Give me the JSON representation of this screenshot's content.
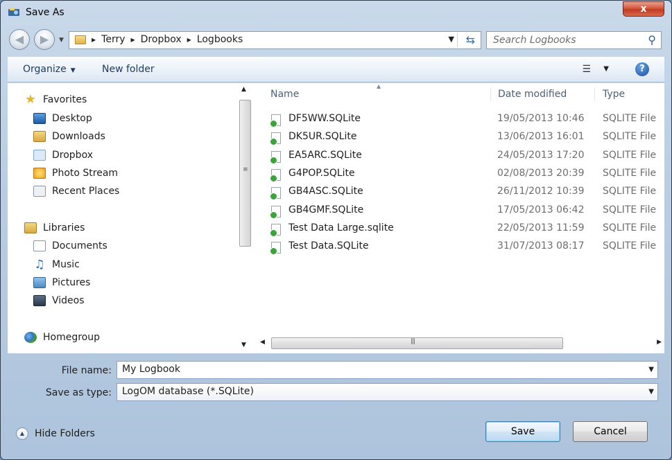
{
  "window": {
    "title": "Save As",
    "close_label": "x"
  },
  "address": {
    "crumbs": [
      "Terry",
      "Dropbox",
      "Logbooks"
    ]
  },
  "search": {
    "placeholder": "Search Logbooks"
  },
  "toolbar": {
    "organize_label": "Organize",
    "new_folder_label": "New folder",
    "help_label": "?"
  },
  "sidebar": {
    "favorites_label": "Favorites",
    "favorites": [
      {
        "label": "Desktop",
        "icon": "desktop-icon"
      },
      {
        "label": "Downloads",
        "icon": "downloads-icon"
      },
      {
        "label": "Dropbox",
        "icon": "dropbox-icon"
      },
      {
        "label": "Photo Stream",
        "icon": "photo-stream-icon"
      },
      {
        "label": "Recent Places",
        "icon": "recent-places-icon"
      }
    ],
    "libraries_label": "Libraries",
    "libraries": [
      {
        "label": "Documents",
        "icon": "documents-icon"
      },
      {
        "label": "Music",
        "icon": "music-icon"
      },
      {
        "label": "Pictures",
        "icon": "pictures-icon"
      },
      {
        "label": "Videos",
        "icon": "videos-icon"
      }
    ],
    "homegroup_label": "Homegroup"
  },
  "file_list": {
    "columns": {
      "name": "Name",
      "date": "Date modified",
      "type": "Type"
    },
    "files": [
      {
        "name": "DF5WW.SQLite",
        "date": "19/05/2013 10:46",
        "type": "SQLITE File"
      },
      {
        "name": "DK5UR.SQLite",
        "date": "13/06/2013 16:01",
        "type": "SQLITE File"
      },
      {
        "name": "EA5ARC.SQLite",
        "date": "24/05/2013 17:20",
        "type": "SQLITE File"
      },
      {
        "name": "G4POP.SQLite",
        "date": "02/08/2013 20:39",
        "type": "SQLITE File"
      },
      {
        "name": "GB4ASC.SQLite",
        "date": "26/11/2012 10:39",
        "type": "SQLITE File"
      },
      {
        "name": "GB4GMF.SQLite",
        "date": "17/05/2013 06:42",
        "type": "SQLITE File"
      },
      {
        "name": "Test Data Large.sqlite",
        "date": "22/05/2013 11:59",
        "type": "SQLITE File"
      },
      {
        "name": "Test Data.SQLite",
        "date": "31/07/2013 08:17",
        "type": "SQLITE File"
      }
    ]
  },
  "form": {
    "file_name_label": "File name:",
    "file_name_value": "My Logbook",
    "save_type_label": "Save as type:",
    "save_type_value": "LogOM database (*.SQLite)"
  },
  "footer": {
    "hide_folders_label": "Hide Folders",
    "save_label": "Save",
    "cancel_label": "Cancel"
  },
  "colors": {
    "title_close": "#c23a22",
    "accent_link": "#1e3a5f",
    "file_ok_badge": "#3aa33a"
  }
}
